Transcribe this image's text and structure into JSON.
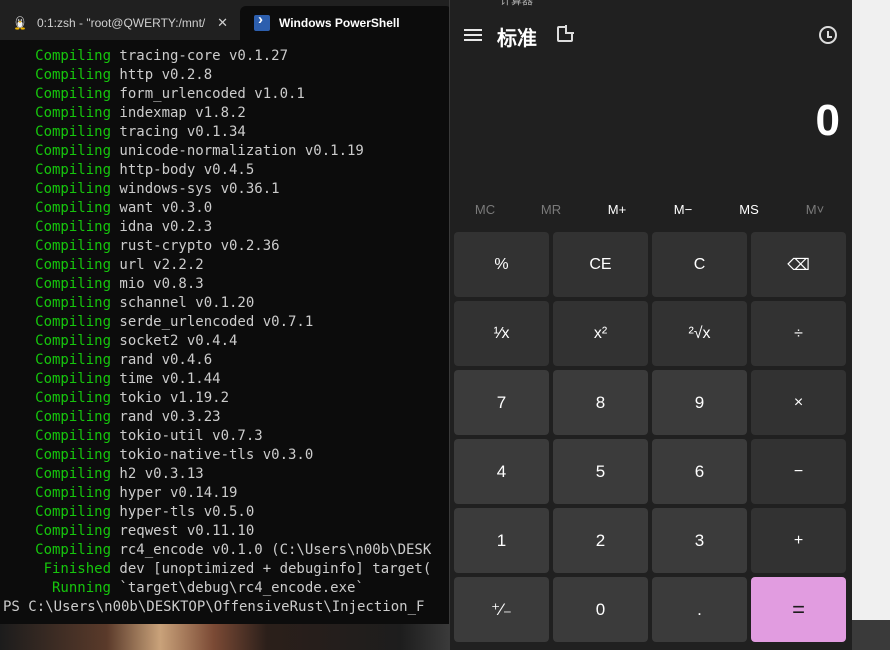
{
  "terminal": {
    "tabs": [
      {
        "label": "0:1:zsh - \"root@QWERTY:/mnt/"
      },
      {
        "label": "Windows PowerShell"
      }
    ],
    "close_glyph": "✕",
    "lines": [
      {
        "status": "Compiling",
        "text": "tracing-core v0.1.27"
      },
      {
        "status": "Compiling",
        "text": "http v0.2.8"
      },
      {
        "status": "Compiling",
        "text": "form_urlencoded v1.0.1"
      },
      {
        "status": "Compiling",
        "text": "indexmap v1.8.2"
      },
      {
        "status": "Compiling",
        "text": "tracing v0.1.34"
      },
      {
        "status": "Compiling",
        "text": "unicode-normalization v0.1.19"
      },
      {
        "status": "Compiling",
        "text": "http-body v0.4.5"
      },
      {
        "status": "Compiling",
        "text": "windows-sys v0.36.1"
      },
      {
        "status": "Compiling",
        "text": "want v0.3.0"
      },
      {
        "status": "Compiling",
        "text": "idna v0.2.3"
      },
      {
        "status": "Compiling",
        "text": "rust-crypto v0.2.36"
      },
      {
        "status": "Compiling",
        "text": "url v2.2.2"
      },
      {
        "status": "Compiling",
        "text": "mio v0.8.3"
      },
      {
        "status": "Compiling",
        "text": "schannel v0.1.20"
      },
      {
        "status": "Compiling",
        "text": "serde_urlencoded v0.7.1"
      },
      {
        "status": "Compiling",
        "text": "socket2 v0.4.4"
      },
      {
        "status": "Compiling",
        "text": "rand v0.4.6"
      },
      {
        "status": "Compiling",
        "text": "time v0.1.44"
      },
      {
        "status": "Compiling",
        "text": "tokio v1.19.2"
      },
      {
        "status": "Compiling",
        "text": "rand v0.3.23"
      },
      {
        "status": "Compiling",
        "text": "tokio-util v0.7.3"
      },
      {
        "status": "Compiling",
        "text": "tokio-native-tls v0.3.0"
      },
      {
        "status": "Compiling",
        "text": "h2 v0.3.13"
      },
      {
        "status": "Compiling",
        "text": "hyper v0.14.19"
      },
      {
        "status": "Compiling",
        "text": "hyper-tls v0.5.0"
      },
      {
        "status": "Compiling",
        "text": "reqwest v0.11.10"
      },
      {
        "status": "Compiling",
        "text": "rc4_encode v0.1.0 (C:\\Users\\n00b\\DESK"
      },
      {
        "status": "Finished",
        "text": "dev [unoptimized + debuginfo] target("
      },
      {
        "status": "Running",
        "text": "`target\\debug\\rc4_encode.exe`"
      }
    ],
    "prompt": "PS C:\\Users\\n00b\\DESKTOP\\OffensiveRust\\Injection_F",
    "status_color": "#16c60c"
  },
  "calculator": {
    "title": "计算器",
    "mode": "标准",
    "display": "0",
    "memory": [
      "MC",
      "MR",
      "M+",
      "M−",
      "MS",
      "M˅"
    ],
    "keys": [
      "%",
      "CE",
      "C",
      "⌫",
      "¹⁄x",
      "x²",
      "²√x",
      "÷",
      "7",
      "8",
      "9",
      "×",
      "4",
      "5",
      "6",
      "−",
      "1",
      "2",
      "3",
      "+",
      "⁺⁄₋",
      "0",
      ".",
      "="
    ],
    "equals_color": "#e19ce0"
  }
}
